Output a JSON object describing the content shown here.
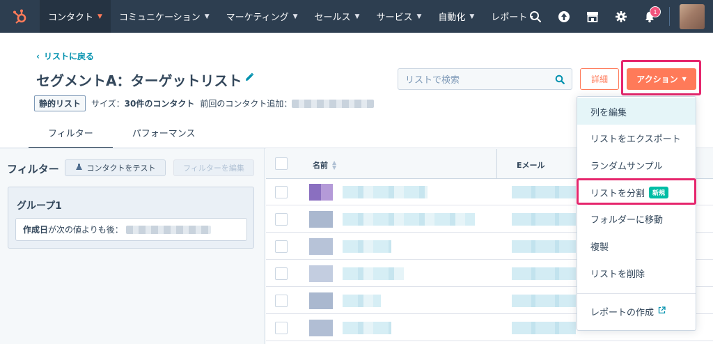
{
  "nav": {
    "items": [
      {
        "label": "コンタクト",
        "active": true
      },
      {
        "label": "コミュニケーション",
        "active": false
      },
      {
        "label": "マーケティング",
        "active": false
      },
      {
        "label": "セールス",
        "active": false
      },
      {
        "label": "サービス",
        "active": false
      },
      {
        "label": "自動化",
        "active": false
      },
      {
        "label": "レポート・",
        "active": false
      }
    ],
    "notification_count": "1",
    "icons": [
      "hubspot-logo-icon",
      "search-icon",
      "upgrade-icon",
      "marketplace-icon",
      "gear-icon",
      "bell-icon"
    ]
  },
  "header": {
    "back_link": "リストに戻る",
    "title": "セグメントA：ターゲットリスト",
    "list_type": "静的リスト",
    "size_label": "サイズ：",
    "size_value": "30件のコンタクト",
    "last_added_label": "前回のコンタクト追加："
  },
  "search": {
    "placeholder": "リストで検索"
  },
  "buttons": {
    "detail": "詳細",
    "action": "アクション"
  },
  "tabs": [
    {
      "label": "フィルター",
      "active": true
    },
    {
      "label": "パフォーマンス",
      "active": false
    }
  ],
  "filter_panel": {
    "title": "フィルター",
    "test_button": "コンタクトをテスト",
    "edit_button": "フィルターを編集",
    "group_title": "グループ1",
    "condition_bold": "作成日",
    "condition_text": "が次の値よりも後："
  },
  "table": {
    "col_name": "名前",
    "col_email": "Eメール"
  },
  "dropdown": {
    "items": [
      {
        "label": "列を編集"
      },
      {
        "label": "リストをエクスポート"
      },
      {
        "label": "ランダムサンプル"
      },
      {
        "label": "リストを分割",
        "badge": "新規"
      },
      {
        "label": "フォルダーに移動"
      },
      {
        "label": "複製"
      },
      {
        "label": "リストを削除"
      },
      {
        "label": "レポートの作成"
      }
    ]
  },
  "colors": {
    "nav_bg": "#2d3e50",
    "accent": "#ff7a59",
    "link": "#0091ae",
    "highlight": "#e6266d",
    "new_badge": "#00bda5"
  }
}
